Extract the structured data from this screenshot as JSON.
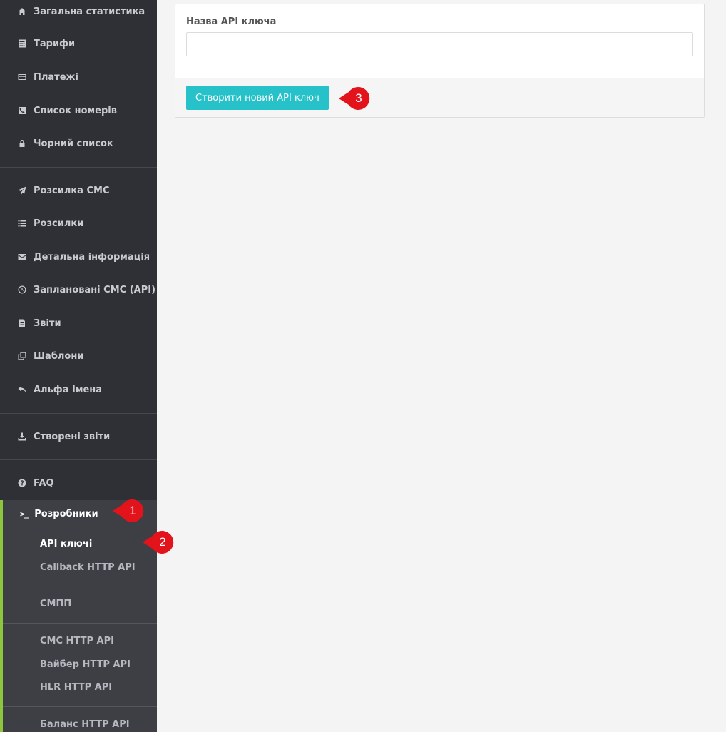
{
  "sidebar": {
    "items": [
      {
        "label": "Загальна статистика",
        "icon": "home-icon"
      },
      {
        "label": "Тарифи",
        "icon": "calculator-icon"
      },
      {
        "label": "Платежі",
        "icon": "credit-card-icon"
      },
      {
        "label": "Список номерів",
        "icon": "phone-icon"
      },
      {
        "label": "Чорний список",
        "icon": "lock-icon"
      },
      {
        "label": "Розсилка СМС",
        "icon": "paper-plane-icon"
      },
      {
        "label": "Розсилки",
        "icon": "list-icon"
      },
      {
        "label": "Детальна інформація",
        "icon": "envelope-icon"
      },
      {
        "label": "Заплановані СМС (API)",
        "icon": "clock-icon"
      },
      {
        "label": "Звіти",
        "icon": "file-icon"
      },
      {
        "label": "Шаблони",
        "icon": "copy-icon"
      },
      {
        "label": "Альфа Імена",
        "icon": "reply-icon"
      },
      {
        "label": "Створені звіти",
        "icon": "download-icon"
      },
      {
        "label": "FAQ",
        "icon": "question-icon"
      }
    ],
    "developers": {
      "label": "Розробники",
      "icon": "terminal-icon",
      "sub_items": [
        {
          "label": "API ключі",
          "active": true
        },
        {
          "label": "Callback HTTP API"
        },
        {
          "label": "СМПП"
        },
        {
          "label": "СМС HTTP API"
        },
        {
          "label": "Вайбер HTTP API"
        },
        {
          "label": "HLR HTTP API"
        },
        {
          "label": "Баланс HTTP API"
        }
      ]
    }
  },
  "main": {
    "form": {
      "label": "Назва API ключа",
      "input_value": "",
      "submit_label": "Створити новий API ключ"
    }
  },
  "annotations": {
    "markers": [
      "1",
      "2",
      "3"
    ],
    "color": "#e3131b"
  },
  "colors": {
    "sidebar_bg": "#2f3035",
    "accent_green": "#8cc63f",
    "button_teal": "#26c1c9"
  }
}
